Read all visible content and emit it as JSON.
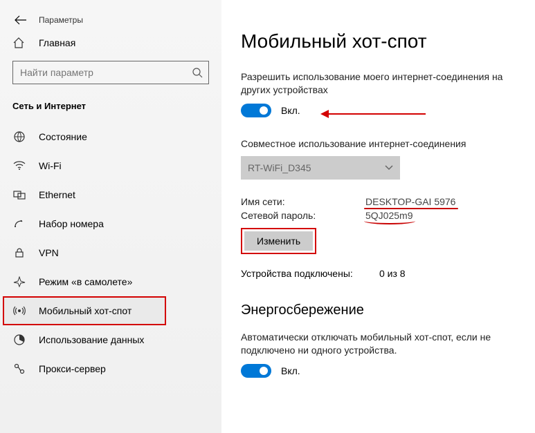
{
  "header": {
    "title": "Параметры"
  },
  "sidebar": {
    "home_label": "Главная",
    "search_placeholder": "Найти параметр",
    "section_label": "Сеть и Интернет",
    "items": [
      {
        "id": "status",
        "label": "Состояние"
      },
      {
        "id": "wifi",
        "label": "Wi-Fi"
      },
      {
        "id": "ethernet",
        "label": "Ethernet"
      },
      {
        "id": "dialup",
        "label": "Набор номера"
      },
      {
        "id": "vpn",
        "label": "VPN"
      },
      {
        "id": "airplane",
        "label": "Режим «в самолете»"
      },
      {
        "id": "hotspot",
        "label": "Мобильный хот-спот"
      },
      {
        "id": "datausage",
        "label": "Использование данных"
      },
      {
        "id": "proxy",
        "label": "Прокси-сервер"
      }
    ]
  },
  "main": {
    "title": "Мобильный хот-спот",
    "share_desc": "Разрешить использование моего интернет-соединения на других устройствах",
    "toggle1_label": "Вкл.",
    "share_conn_label": "Совместное использование интернет-соединения",
    "share_conn_value": "RT-WiFi_D345",
    "net_name_label": "Имя сети:",
    "net_name_value": "DESKTOP-GAI 5976",
    "net_pass_label": "Сетевой пароль:",
    "net_pass_value": "5QJ025m9",
    "edit_btn": "Изменить",
    "devices_label": "Устройства подключены:",
    "devices_value": "0 из 8",
    "power_h": "Энергосбережение",
    "power_desc": "Автоматически отключать мобильный хот-спот, если не подключено ни одного устройства.",
    "toggle2_label": "Вкл."
  }
}
